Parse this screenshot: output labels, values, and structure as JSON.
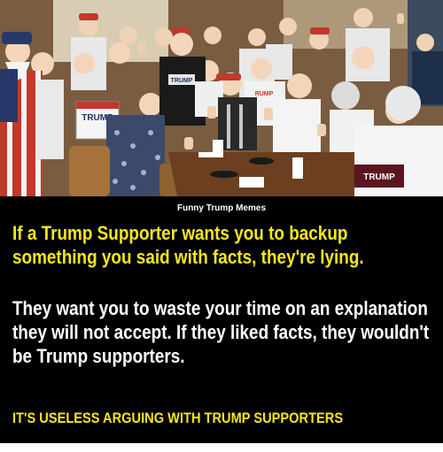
{
  "photo": {
    "signs": [
      "TRUMP",
      "TRUMP",
      "TRUMP",
      "TRUMP"
    ]
  },
  "source_label": "Funny Trump Memes",
  "headline": "If a Trump Supporter wants you to backup something you said with facts, they're lying.",
  "body": "They want you to waste your time on an explanation they will not accept. If they liked facts, they wouldn't be Trump supporters.",
  "conclusion": "IT'S USELESS ARGUING WITH TRUMP SUPPORTERS",
  "colors": {
    "caption_background": "#000000",
    "highlight_text": "#f5e61e",
    "body_text": "#ffffff"
  }
}
